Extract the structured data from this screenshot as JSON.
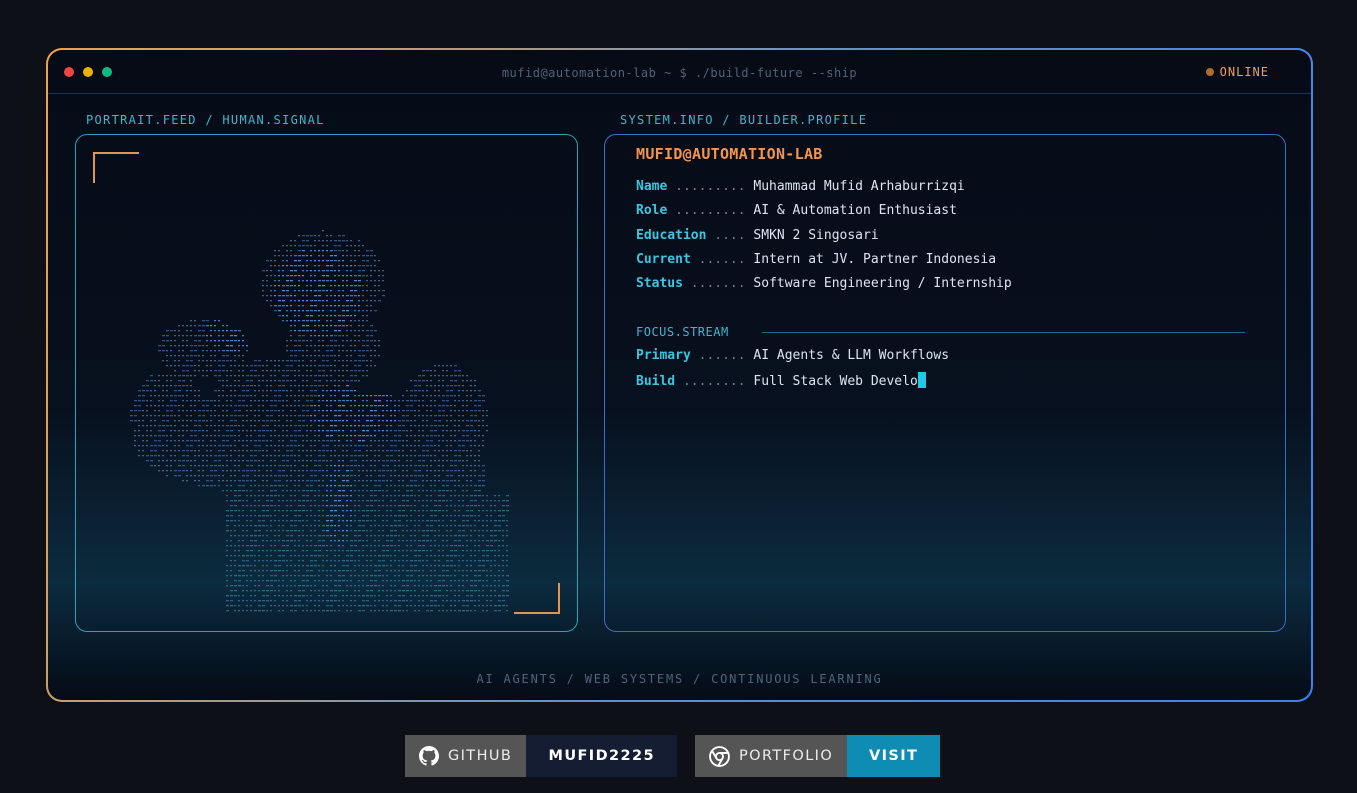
{
  "window": {
    "title": "mufid@automation-lab ~ $ ./build-future --ship",
    "status": "ONLINE"
  },
  "portrait": {
    "label": "PORTRAIT.FEED / HUMAN.SIGNAL"
  },
  "profile": {
    "label": "SYSTEM.INFO / BUILDER.PROFILE",
    "heading": "MUFID@AUTOMATION-LAB",
    "rows": [
      {
        "key": "Name",
        "dots": " ......... ",
        "value": "Muhammad Mufid Arhaburrizqi"
      },
      {
        "key": "Role",
        "dots": " ......... ",
        "value": "AI & Automation Enthusiast"
      },
      {
        "key": "Education",
        "dots": " .... ",
        "value": "SMKN 2 Singosari"
      },
      {
        "key": "Current",
        "dots": " ...... ",
        "value": "Intern at JV. Partner Indonesia"
      },
      {
        "key": "Status",
        "dots": " ....... ",
        "value": "Software Engineering / Internship"
      }
    ],
    "focus_label": "FOCUS.STREAM",
    "focus_rows": [
      {
        "key": "Primary",
        "dots": " ...... ",
        "value": "AI Agents & LLM Workflows"
      },
      {
        "key": "Build",
        "dots": " ........ ",
        "value": "Full Stack Web Develo"
      }
    ]
  },
  "footer": "AI AGENTS / WEB SYSTEMS / CONTINUOUS LEARNING",
  "badges": [
    {
      "icon": "github-icon",
      "label": "GITHUB",
      "value": "MUFID2225",
      "value_color": "#151d33"
    },
    {
      "icon": "chrome-icon",
      "label": "PORTFOLIO",
      "value": "VISIT",
      "value_color": "#0e8cb3"
    }
  ]
}
